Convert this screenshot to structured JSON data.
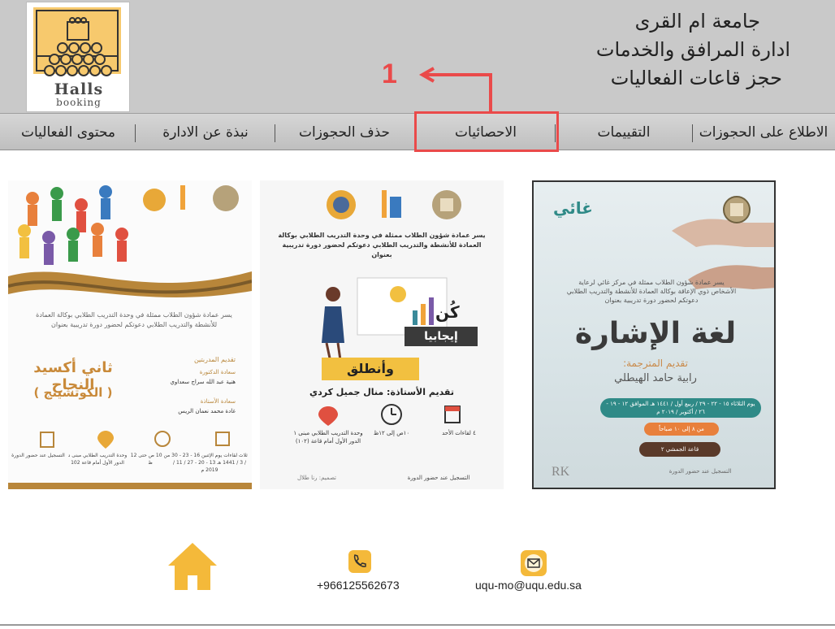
{
  "header": {
    "logo": {
      "word1": "Halls",
      "word2": "booking"
    },
    "title_lines": [
      "جامعة ام القرى",
      "ادارة المرافق والخدمات",
      "حجز قاعات الفعاليات"
    ]
  },
  "annotation": {
    "number": "1"
  },
  "nav": {
    "items": [
      "الاطلاع على الحجوزات",
      "التقييمات",
      "الاحصائيات",
      "حذف الحجوزات",
      "نبذة عن الادارة",
      "محتوى الفعاليات"
    ]
  },
  "posters": [
    {
      "brand": "غائي",
      "intro": "يسر عمادة شؤون الطلاب ممثلة في مركز غائي لرعاية الأشخاص ذوي الإعاقة بوكالة العمادة للأنشطة والتدريب الطلابي دعوتكم لحضور دورة تدريبية بعنوان",
      "title": "لغة الإشارة",
      "presenter_label": "تقديم المترجمة:",
      "presenter": "رابية حامد الهيطلي",
      "date": "يوم الثلاثاء ١٥ - ٢٢ - ٢٩ / ربيع أول / ١٤٤١ هـ الموافق ١٢ - ١٩ - ٢٦ / أكتوبر / ٢٠١٩ م",
      "time": "من ٨ إلى ١٠ صباحاً",
      "location": "قاعة الجمشي ٢",
      "note": "التسجيل عند حضور الدورة",
      "mark": "RK"
    },
    {
      "intro": "يسر عمادة شؤون الطلاب ممثلة في وحدة التدريب الطلابي بوكالة العمادة للأنشطة والتدريب الطلابي دعوتكم لحضور دورة تدريبية بعنوان",
      "slogan1": "كُن",
      "slogan2": "إيجابيا",
      "slogan3": "وأنطلق",
      "presenter": "تقديم الأستاذة: منال جميل كردي",
      "info_days": "٤ لقاءات الأحد",
      "info_time": "١٠ص إلى ١٢ظ",
      "info_place": "وحدة التدريب الطلابي مبنى ١ الدور الأول أمام قاعة (١٠٢)",
      "note": "التسجيل عند حضور الدورة",
      "design": "تصميم: رنا طلال"
    },
    {
      "intro": "يسر عمادة شؤون الطلاب ممثلة في وحدة التدريب الطلابي بوكالة العمادة للأنشطة والتدريب الطلابي دعوتكم لحضور دورة تدريبية بعنوان",
      "title": "ثاني أكسيد النجاح",
      "subtitle": "( الكوتشينج )",
      "label_presenters": "تقديم المدربتين",
      "p1_role": "سعادة الدكتورة",
      "p1_name": "هنية عبد الله سراج سعداوي",
      "p2_role": "سعادة الأستاذة",
      "p2_name": "غادة محمد نعمان الريس",
      "days": "ثلاث لقاءات يوم الإثنين 16 - 23 - 30 / 3 / 1441 هـ 13 - 20 - 27 / 11 / 2019 م",
      "time": "من 10 ص حتى 12 ظ",
      "place": "وحدة التدريب الطلابي مبنى د الدور الأول أمام قاعة 102",
      "note": "التسجيل عند حضور الدورة"
    }
  ],
  "footer": {
    "phone": "+966125562673",
    "email": "uqu-mo@uqu.edu.sa"
  },
  "colors": {
    "accent": "#ea4a4a",
    "home": "#f4b93a",
    "teal": "#2f8a87"
  }
}
